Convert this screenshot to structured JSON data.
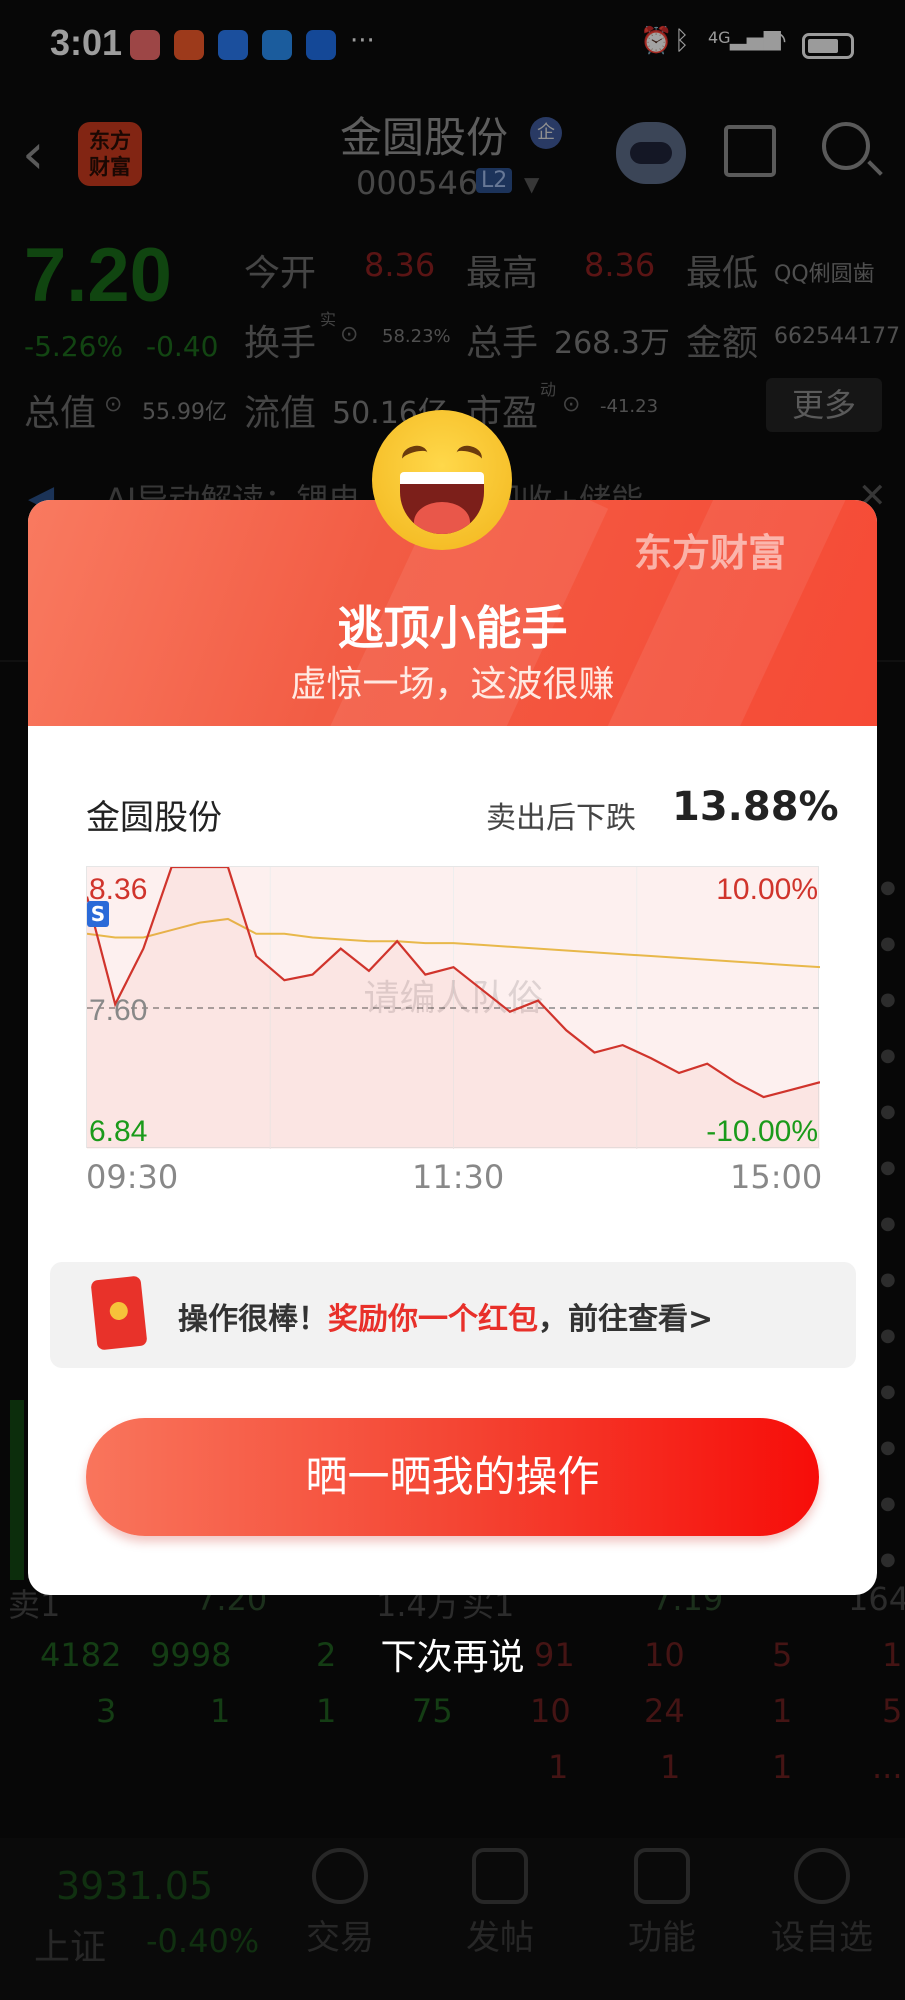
{
  "status_bar": {
    "time": "3:01",
    "more": "···",
    "signal_label": "4G"
  },
  "header": {
    "logo_line1": "东方",
    "logo_line2": "财富",
    "stock_name": "金圆股份",
    "badge": "企",
    "stock_code": "000546",
    "level": "L2"
  },
  "quote": {
    "price": "7.20",
    "change_pct": "-5.26%",
    "change": "-0.40",
    "open_label": "今开",
    "open": "8.36",
    "high_label": "最高",
    "high": "8.36",
    "low_label": "最低",
    "low": "QQ俐圆歯",
    "turnover_label": "换手",
    "turnover_sup": "实",
    "turnover": "58.23%",
    "volume_label": "总手",
    "volume": "268.3万",
    "amount_label": "金额",
    "amount": "662544177",
    "mktcap_label": "总值",
    "mktcap": "55.99亿",
    "float_label": "流值",
    "float": "50.16亿",
    "pe_label": "市盈",
    "pe_sup": "动",
    "pe": "-41.23",
    "more_button": "更多"
  },
  "ai_banner": "AI异动解读：锂电　　电池回收+储能",
  "order_book": {
    "sell_label": "卖1",
    "sell_price": "7.20",
    "sell_vol": "1.4万",
    "buy_label": "买1",
    "buy_price": "7.19",
    "buy_vol": "164",
    "row1_left": [
      "4182",
      "9998",
      "2",
      "91"
    ],
    "row1_right": [
      "10",
      "5",
      "1"
    ],
    "row2_left": [
      "3",
      "1",
      "1",
      "75"
    ],
    "row2_right": [
      "10",
      "24",
      "1",
      "5"
    ],
    "row3_right": [
      "1",
      "1",
      "1",
      "..."
    ]
  },
  "bottom_nav": {
    "index_value": "3931.05",
    "index_name": "上证",
    "index_change": "-0.40%",
    "items": [
      "交易",
      "发帖",
      "功能",
      "设自选"
    ]
  },
  "modal": {
    "brand": "东方财富",
    "title": "逃顶小能手",
    "subtitle": "虚惊一场，这波很赚",
    "stock_name": "金圆股份",
    "drop_label": "卖出后下跌",
    "drop_pct": "13.88%",
    "sell_marker": "S",
    "watermark": "请编人队俗",
    "reward_prefix": "操作很棒！",
    "reward_highlight": "奖励你一个红包",
    "reward_suffix": "，前往查看>",
    "share_button": "晒一晒我的操作",
    "later_button": "下次再说"
  },
  "colors": {
    "accent_red": "#e8302a",
    "up_red": "#d0342c",
    "down_green": "#1a9a1a",
    "avg_line": "#e8b84a"
  },
  "chart_data": {
    "type": "line",
    "x_ticks": [
      "09:30",
      "11:30",
      "15:00"
    ],
    "y_left_ticks": [
      "8.36",
      "7.60",
      "6.84"
    ],
    "y_right_ticks": [
      "10.00%",
      "-10.00%"
    ],
    "ylim": [
      6.84,
      8.36
    ],
    "prev_close": 7.6,
    "x": [
      "09:30",
      "09:35",
      "09:40",
      "09:45",
      "09:50",
      "10:00",
      "10:10",
      "10:20",
      "10:30",
      "10:40",
      "10:50",
      "11:00",
      "11:10",
      "11:20",
      "11:30",
      "13:10",
      "13:20",
      "13:30",
      "13:40",
      "13:50",
      "14:00",
      "14:10",
      "14:20",
      "14:30",
      "14:40",
      "14:50",
      "15:00"
    ],
    "series": [
      {
        "values": [
          8.2,
          7.62,
          7.92,
          8.36,
          8.36,
          8.36,
          7.88,
          7.75,
          7.78,
          7.92,
          7.8,
          7.96,
          7.78,
          7.82,
          7.7,
          7.58,
          7.64,
          7.48,
          7.36,
          7.4,
          7.33,
          7.25,
          7.3,
          7.2,
          7.12,
          7.16,
          7.2
        ]
      },
      {
        "values": [
          8.0,
          7.98,
          7.98,
          8.02,
          8.06,
          8.08,
          8.0,
          8.0,
          7.98,
          7.97,
          7.96,
          7.96,
          7.95,
          7.95,
          7.94,
          7.93,
          7.92,
          7.91,
          7.9,
          7.89,
          7.88,
          7.87,
          7.86,
          7.85,
          7.84,
          7.83,
          7.82
        ]
      }
    ]
  }
}
